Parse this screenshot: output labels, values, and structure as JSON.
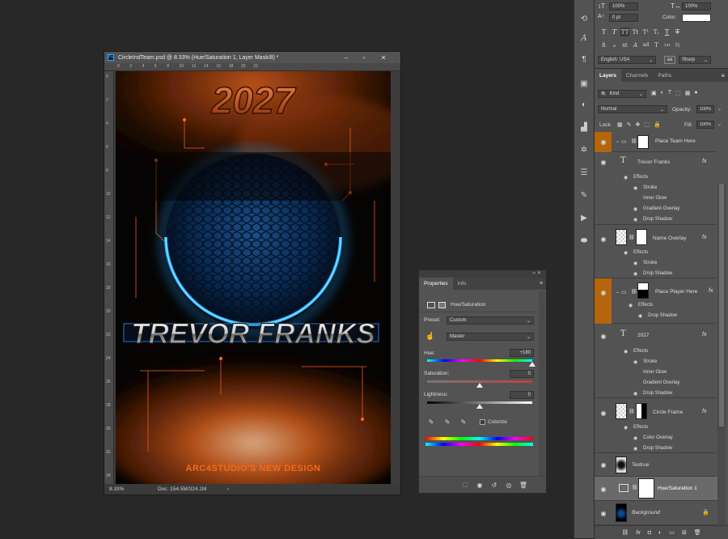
{
  "document": {
    "title": "CircleIndTeam.psd @ 8.33% (Hue/Saturation 1, Layer Mask/8) *",
    "zoom": "8.33%",
    "doc_info": "Doc: 154.5M/324.1M",
    "ruler_top": [
      "0",
      "2",
      "4",
      "6",
      "8",
      "10",
      "12",
      "14",
      "16",
      "18",
      "20",
      "22"
    ],
    "ruler_left": [
      "0",
      "2",
      "4",
      "6",
      "8",
      "10",
      "12",
      "14",
      "16",
      "18",
      "20",
      "22",
      "24",
      "26",
      "28",
      "30",
      "32",
      "34"
    ]
  },
  "artwork": {
    "year": "2027",
    "name": "TREVOR FRANKS",
    "tagline": "ARC4STUDIO'S NEW DESIGN"
  },
  "properties": {
    "tabs": [
      "Properties",
      "Info"
    ],
    "adjustment": "Hue/Saturation",
    "preset_label": "Preset:",
    "preset_value": "Custom",
    "channel_value": "Master",
    "hue_label": "Hue:",
    "hue_value": "+180",
    "hue_level": 1.0,
    "saturation_label": "Saturation:",
    "saturation_value": "0",
    "saturation_level": 0.5,
    "lightness_label": "Lightness:",
    "lightness_value": "0",
    "lightness_level": 0.5,
    "colorize_label": "Colorize"
  },
  "character": {
    "vscale": "100%",
    "hscale": "100%",
    "tracking": "0 pt",
    "color_label": "Color:",
    "language": "English: USA",
    "aa_icon": "aa",
    "antialias": "Sharp",
    "style_buttons": [
      "T",
      "T",
      "TT",
      "Tt",
      "T¹",
      "T₁",
      "T",
      "T"
    ],
    "ot_buttons": [
      "fi",
      "ℴ",
      "st",
      "A",
      "ad",
      "T",
      "1st",
      "½"
    ]
  },
  "layers_panel": {
    "tabs": [
      "Layers",
      "Channels",
      "Paths"
    ],
    "filter_kind": "Kind",
    "blend_mode": "Normal",
    "opacity_label": "Opacity:",
    "opacity_value": "100%",
    "lock_label": "Lock:",
    "fill_label": "Fill:",
    "fill_value": "100%",
    "layers": [
      {
        "name": "Place Team Here"
      },
      {
        "name": "Trevor Franks",
        "effects_label": "Effects",
        "effects": [
          "Stroke",
          "Inner Glow",
          "Gradient Overlay",
          "Drop Shadow"
        ]
      },
      {
        "name": "Name Overlay",
        "effects_label": "Effects",
        "effects": [
          "Stroke",
          "Drop Shadow"
        ]
      },
      {
        "name": "Place Player Here",
        "effects_label": "Effects",
        "effects": [
          "Drop Shadow"
        ]
      },
      {
        "name": "2027",
        "effects_label": "Effects",
        "effects": [
          "Stroke",
          "Inner Glow",
          "Gradient Overlay",
          "Drop Shadow"
        ]
      },
      {
        "name": "Circle Frame",
        "effects_label": "Effects",
        "effects": [
          "Color Overlay",
          "Drop Shadow"
        ]
      },
      {
        "name": "Textrue"
      },
      {
        "name": "Hue/Saturation 1"
      },
      {
        "name": "Background"
      }
    ],
    "fx_label": "fx",
    "bottom_fx": "fx"
  },
  "colors": {
    "accent_orange": "#f26a1b",
    "glow_blue": "#1fa3ff",
    "panel_bg": "#535353",
    "group_highlight": "#b5650c",
    "ps_blue": "#31a8ff"
  }
}
